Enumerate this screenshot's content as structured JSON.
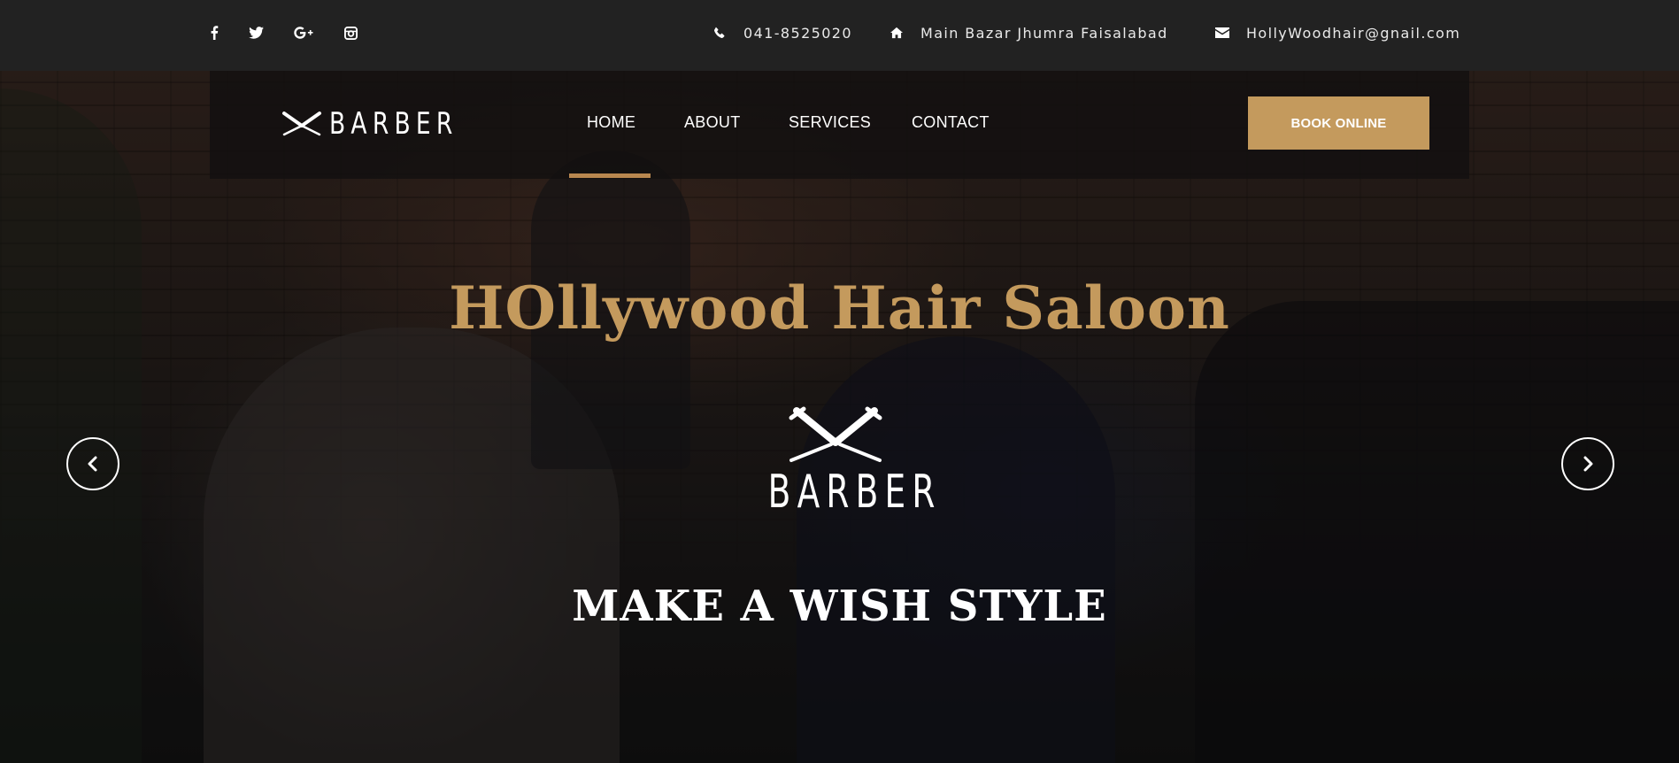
{
  "topbar": {
    "social": [
      {
        "icon": "facebook-icon",
        "glyph": "f"
      },
      {
        "icon": "twitter-icon",
        "glyph": ""
      },
      {
        "icon": "google-plus-icon",
        "glyph": "G+"
      },
      {
        "icon": "instagram-icon",
        "glyph": ""
      }
    ],
    "phone": "041-8525020",
    "address": "Main Bazar Jhumra Faisalabad",
    "email": "HollyWoodhair@gnail.com"
  },
  "header": {
    "logo_text": "BARBER",
    "nav": [
      {
        "label": "HOME",
        "active": true
      },
      {
        "label": "ABOUT",
        "active": false
      },
      {
        "label": "SERVICES",
        "active": false
      },
      {
        "label": "CONTACT",
        "active": false
      }
    ],
    "book_label": "BOOK ONLINE"
  },
  "hero": {
    "title": "HOllywood Hair Saloon",
    "logo_text": "BARBER",
    "subtitle": "MAKE A WISH STYLE",
    "prev_icon": "chevron-left-icon",
    "next_icon": "chevron-right-icon"
  },
  "colors": {
    "accent": "#c49a5d",
    "topbar_bg": "#222222",
    "text": "#ffffff"
  }
}
